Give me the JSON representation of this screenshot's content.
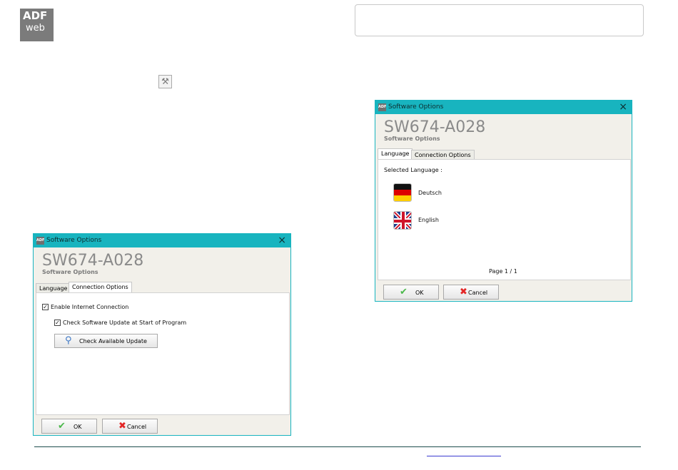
{
  "logo": {
    "line1": "ADF",
    "line2": "web"
  },
  "wrench_icon": "wrench-icon",
  "dialog_right": {
    "titlebar": "Software Options",
    "title": "SW674-A028",
    "subtitle": "Software Options",
    "tabs": [
      "Language",
      "Connection Options"
    ],
    "active_tab": "Language",
    "selected_language_label": "Selected Language :",
    "languages": [
      {
        "name": "Deutsch",
        "flag": "germany-flag"
      },
      {
        "name": "English",
        "flag": "uk-flag"
      }
    ],
    "page": "Page 1 / 1",
    "ok": "OK",
    "cancel": "Cancel"
  },
  "dialog_left": {
    "titlebar": "Software Options",
    "title": "SW674-A028",
    "subtitle": "Software Options",
    "tabs": [
      "Language",
      "Connection Options"
    ],
    "active_tab": "Connection Options",
    "enable_internet": "Enable Internet Connection",
    "enable_internet_checked": true,
    "check_update_start": "Check Software Update at Start of Program",
    "check_update_start_checked": true,
    "check_available_update": "Check Available Update",
    "ok": "OK",
    "cancel": "Cancel"
  },
  "colors": {
    "titlebar": "#18b4bf",
    "window_bg": "#f2f0ea",
    "footer_line": "#1d4d4d"
  }
}
